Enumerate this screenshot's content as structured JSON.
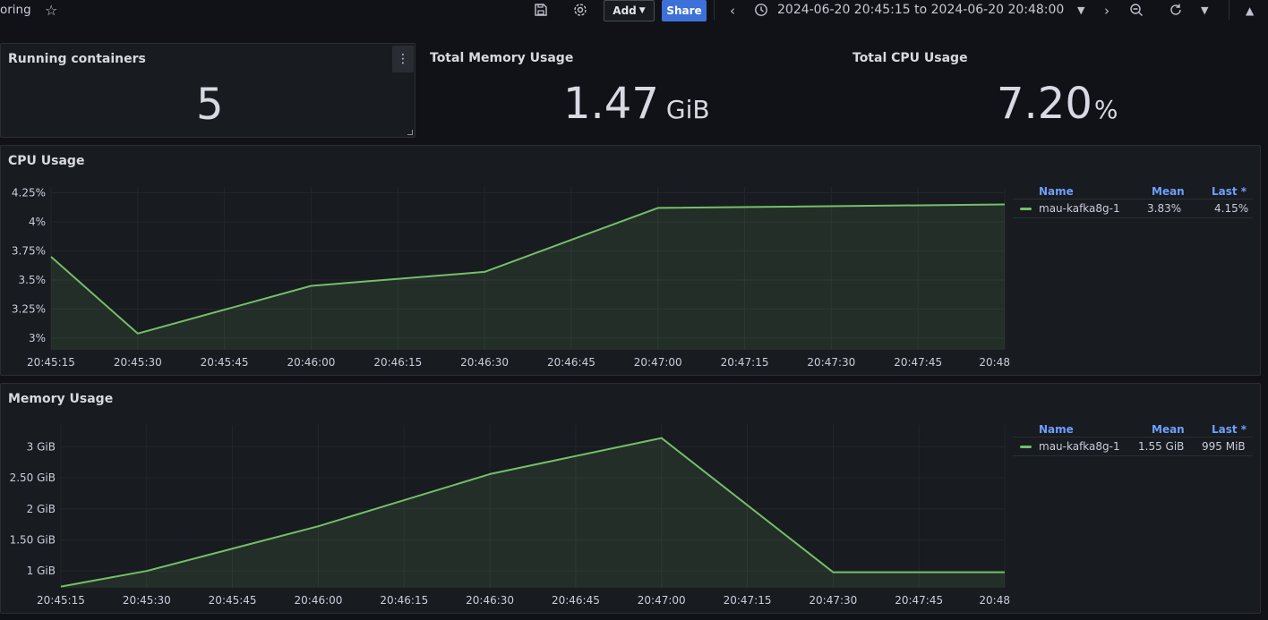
{
  "topbar": {
    "crumb": "oring",
    "add_label": "Add",
    "share_label": "Share",
    "time_range": "2024-06-20 20:45:15 to 2024-06-20 20:48:00",
    "icons": [
      "star-icon",
      "save-icon",
      "gear-icon",
      "chevron-down-icon",
      "chevron-left-icon",
      "clock-icon",
      "chevron-right-icon",
      "zoom-out-icon",
      "refresh-icon",
      "chevron-up-icon"
    ]
  },
  "stats": {
    "running": {
      "title": "Running containers",
      "value": "5"
    },
    "memory": {
      "title": "Total Memory Usage",
      "value": "1.47",
      "unit": "GiB"
    },
    "cpu": {
      "title": "Total CPU Usage",
      "value": "7.20",
      "unit": "%"
    }
  },
  "cpu_panel": {
    "title": "CPU Usage",
    "legend": {
      "name_header": "Name",
      "mean_header": "Mean",
      "last_header": "Last *",
      "series": "mau-kafka8g-1",
      "mean": "3.83%",
      "last": "4.15%"
    }
  },
  "mem_panel": {
    "title": "Memory Usage",
    "legend": {
      "name_header": "Name",
      "mean_header": "Mean",
      "last_header": "Last *",
      "series": "mau-kafka8g-1",
      "mean": "1.55 GiB",
      "last": "995 MiB"
    }
  },
  "colors": {
    "series": "#73bf69",
    "accent": "#3d71d9",
    "legend_header": "#6e9fff"
  },
  "chart_data": [
    {
      "type": "line",
      "title": "CPU Usage",
      "x": [
        "20:45:15",
        "20:45:30",
        "20:46:00",
        "20:46:30",
        "20:47:00",
        "20:48"
      ],
      "x_seconds": [
        0,
        15,
        45,
        75,
        105,
        165
      ],
      "series": [
        {
          "name": "mau-kafka8g-1",
          "values": [
            3.7,
            3.04,
            3.45,
            3.57,
            4.12,
            4.15
          ]
        }
      ],
      "x_ticks": [
        "20:45:15",
        "20:45:30",
        "20:45:45",
        "20:46:00",
        "20:46:15",
        "20:46:30",
        "20:46:45",
        "20:47:00",
        "20:47:15",
        "20:47:30",
        "20:47:45",
        "20:48"
      ],
      "y_ticks": [
        "4.25%",
        "4%",
        "3.75%",
        "3.5%",
        "3.25%",
        "3%"
      ],
      "y_tick_values": [
        4.25,
        4.0,
        3.75,
        3.5,
        3.25,
        3.0
      ],
      "ylim": [
        2.9,
        4.3
      ],
      "grid": true,
      "legend": "right"
    },
    {
      "type": "line",
      "title": "Memory Usage",
      "x": [
        "20:45:15",
        "20:45:30",
        "20:46:00",
        "20:46:30",
        "20:47:00",
        "20:47:30",
        "20:48"
      ],
      "x_seconds": [
        0,
        15,
        45,
        75,
        105,
        135,
        165
      ],
      "series": [
        {
          "name": "mau-kafka8g-1",
          "values": [
            0.75,
            1.0,
            1.72,
            2.56,
            3.14,
            0.98,
            0.98
          ]
        }
      ],
      "x_ticks": [
        "20:45:15",
        "20:45:30",
        "20:45:45",
        "20:46:00",
        "20:46:15",
        "20:46:30",
        "20:46:45",
        "20:47:00",
        "20:47:15",
        "20:47:30",
        "20:47:45",
        "20:48"
      ],
      "y_ticks": [
        "3 GiB",
        "2.50 GiB",
        "2 GiB",
        "1.50 GiB",
        "1 GiB"
      ],
      "y_tick_values": [
        3.0,
        2.5,
        2.0,
        1.5,
        1.0
      ],
      "ylim": [
        0.73,
        3.35
      ],
      "grid": true,
      "legend": "right"
    }
  ]
}
